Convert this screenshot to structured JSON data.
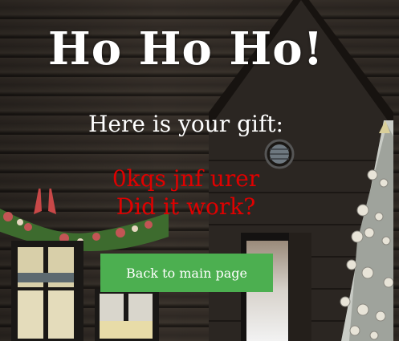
{
  "page": {
    "heading": "Ho Ho Ho!",
    "subheading": "Here is your gift:",
    "gift_line_1": "0kqs jnf urer",
    "gift_line_2": "Did it work?"
  },
  "actions": {
    "back_label": "Back to main page"
  },
  "colors": {
    "heading_text": "#ffffff",
    "gift_text": "#e00000",
    "button_bg": "#4caf50",
    "button_text": "#ffffff"
  },
  "background": {
    "scene_icon": "christmas-cabin-scene"
  }
}
